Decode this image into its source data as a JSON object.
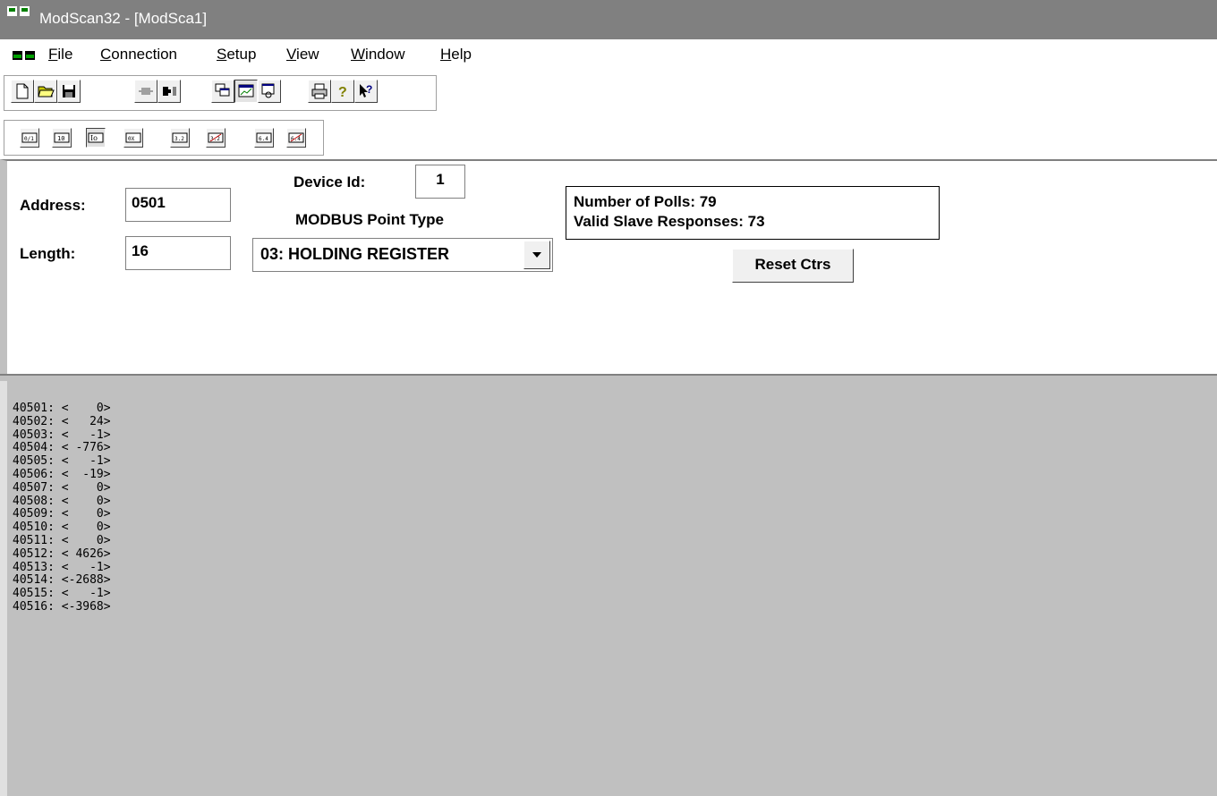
{
  "window": {
    "title": "ModScan32 - [ModSca1]"
  },
  "menu": [
    {
      "pre": "",
      "key": "F",
      "post": "ile"
    },
    {
      "pre": "",
      "key": "C",
      "post": "onnection"
    },
    {
      "pre": "",
      "key": "S",
      "post": "etup"
    },
    {
      "pre": "",
      "key": "V",
      "post": "iew"
    },
    {
      "pre": "",
      "key": "W",
      "post": "indow"
    },
    {
      "pre": "",
      "key": "H",
      "post": "elp"
    }
  ],
  "display_formats": [
    "0/1",
    "10",
    "Io",
    "0X",
    "3.2",
    "3.2",
    "6.4",
    "6.4"
  ],
  "form": {
    "address_label": "Address:",
    "address_value": "0501",
    "device_id_label": "Device Id:",
    "device_id_value": "1",
    "point_type_label": "MODBUS Point Type",
    "length_label": "Length:",
    "length_value": "16",
    "point_type_value": "03: HOLDING REGISTER"
  },
  "stats": {
    "polls": "Number of Polls: 79",
    "valid": "Valid Slave Responses: 73",
    "reset_label": "Reset Ctrs"
  },
  "registers": [
    {
      "addr": "40501",
      "value": "0"
    },
    {
      "addr": "40502",
      "value": "24"
    },
    {
      "addr": "40503",
      "value": "-1"
    },
    {
      "addr": "40504",
      "value": "-776"
    },
    {
      "addr": "40505",
      "value": "-1"
    },
    {
      "addr": "40506",
      "value": "-19"
    },
    {
      "addr": "40507",
      "value": "0"
    },
    {
      "addr": "40508",
      "value": "0"
    },
    {
      "addr": "40509",
      "value": "0"
    },
    {
      "addr": "40510",
      "value": "0"
    },
    {
      "addr": "40511",
      "value": "0"
    },
    {
      "addr": "40512",
      "value": "4626"
    },
    {
      "addr": "40513",
      "value": "-1"
    },
    {
      "addr": "40514",
      "value": "-2688"
    },
    {
      "addr": "40515",
      "value": "-1"
    },
    {
      "addr": "40516",
      "value": "-3968"
    }
  ],
  "colors": {
    "titlebar": "#808080",
    "data_bg": "#c0c0c0",
    "icon_green": "#008000"
  }
}
